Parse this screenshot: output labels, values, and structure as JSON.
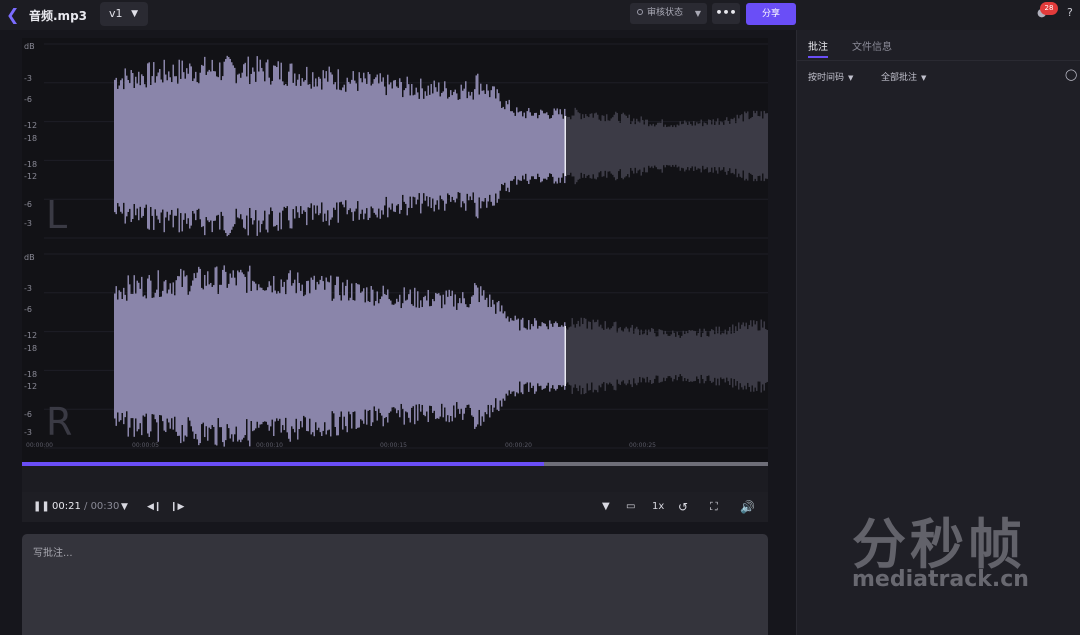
{
  "header": {
    "back_icon": "chevron-left-icon",
    "file_name": "音频.mp3",
    "version": "v1",
    "review_status": "审核状态",
    "more_label": "•••",
    "share_label": "分享",
    "notification_count": "28",
    "help_label": "?"
  },
  "waveform": {
    "db_labels_left": [
      "dB",
      "-3",
      "-6",
      "-12",
      "-18",
      "-18",
      "-12",
      "-6",
      "-3"
    ],
    "db_labels_right": [
      "dB",
      "-3",
      "-6",
      "-12",
      "-18",
      "-18",
      "-12",
      "-6",
      "-3"
    ],
    "channel_left": "L",
    "channel_right": "R",
    "time_ticks": [
      "00:00:00",
      "00:00:05",
      "00:00:10",
      "00:00:15",
      "00:00:20",
      "00:00:25"
    ],
    "played_fraction": 0.7,
    "colors": {
      "played": "#8a85aa",
      "unplayed": "#3c3b46",
      "accent": "#6a4ef7"
    }
  },
  "player": {
    "current_time": "00:21",
    "total_time": "/ 00:30",
    "speed": "1x",
    "icons": [
      "pause-icon",
      "chevron-down-icon",
      "step-back-icon",
      "step-forward-icon",
      "filter-icon",
      "caption-icon",
      "loop-icon",
      "fullscreen-icon",
      "volume-icon"
    ]
  },
  "comment": {
    "placeholder": "写批注..."
  },
  "panel": {
    "tabs": [
      "批注",
      "文件信息"
    ],
    "sort_label": "按时间码",
    "filter_label": "全部批注",
    "headset_icon": "headset-icon"
  },
  "watermark": {
    "cn": "分秒帧",
    "en": "mediatrack.cn"
  }
}
